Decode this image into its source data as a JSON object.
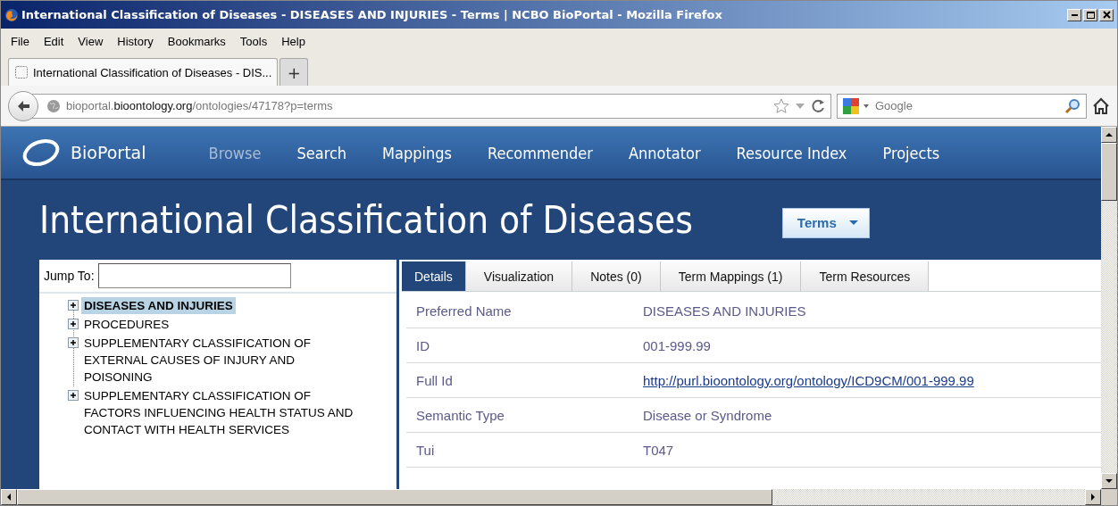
{
  "window": {
    "title": "International Classification of Diseases - DISEASES AND INJURIES - Terms | NCBO BioPortal - Mozilla Firefox"
  },
  "menu": [
    "File",
    "Edit",
    "View",
    "History",
    "Bookmarks",
    "Tools",
    "Help"
  ],
  "browser_tabs": [
    {
      "label": "International Classification of Diseases - DIS...",
      "selected": true
    }
  ],
  "new_tab": "+",
  "address_bar": {
    "prefix": "bioportal.",
    "domain": "bioontology.org",
    "path": "/ontologies/47178?p=terms"
  },
  "search_field": {
    "placeholder": "Google"
  },
  "site_nav": {
    "brand": "BioPortal",
    "items": [
      {
        "label": "Browse",
        "selected": true
      },
      {
        "label": "Search",
        "selected": false
      },
      {
        "label": "Mappings",
        "selected": false
      },
      {
        "label": "Recommender",
        "selected": false
      },
      {
        "label": "Annotator",
        "selected": false
      },
      {
        "label": "Resource Index",
        "selected": false
      },
      {
        "label": "Projects",
        "selected": false
      }
    ]
  },
  "page_title": "International Classification of Diseases",
  "view_dropdown": "Terms",
  "jump_to": {
    "label": "Jump To:"
  },
  "tree": [
    {
      "label": "DISEASES AND INJURIES",
      "selected": true,
      "expanded": false
    },
    {
      "label": "PROCEDURES",
      "selected": false,
      "expanded": false
    },
    {
      "label": "SUPPLEMENTARY CLASSIFICATION OF EXTERNAL CAUSES OF INJURY AND POISONING",
      "selected": false,
      "expanded": false
    },
    {
      "label": "SUPPLEMENTARY CLASSIFICATION OF FACTORS INFLUENCING HEALTH STATUS AND CONTACT WITH HEALTH SERVICES",
      "selected": false,
      "expanded": false
    }
  ],
  "detail_tabs": [
    {
      "label": "Details",
      "selected": true
    },
    {
      "label": "Visualization",
      "selected": false
    },
    {
      "label": "Notes (0)",
      "selected": false
    },
    {
      "label": "Term Mappings (1)",
      "selected": false
    },
    {
      "label": "Term Resources",
      "selected": false
    }
  ],
  "details": [
    {
      "label": "Preferred Name",
      "value": "DISEASES AND INJURIES",
      "kind": "text"
    },
    {
      "label": "ID",
      "value": "001-999.99",
      "kind": "text"
    },
    {
      "label": "Full Id",
      "value": "http://purl.bioontology.org/ontology/ICD9CM/001-999.99",
      "kind": "link"
    },
    {
      "label": "Semantic Type",
      "value": "Disease or Syndrome",
      "kind": "text"
    },
    {
      "label": "Tui",
      "value": "T047",
      "kind": "text"
    }
  ]
}
